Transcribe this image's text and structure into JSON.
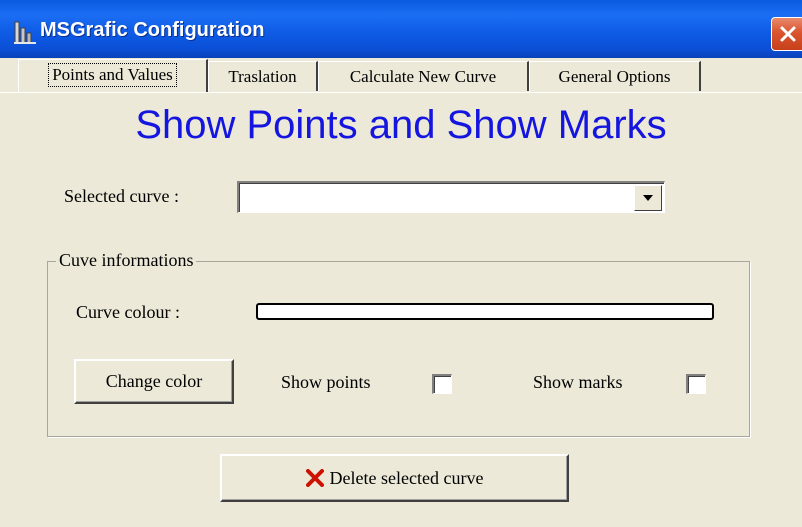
{
  "window": {
    "title": "MSGrafic Configuration",
    "title_color": "#ffffff",
    "titlebar_color": "#0b52dc",
    "close_button_color": "#d9542f"
  },
  "tabs": [
    {
      "label": "Points and Values",
      "active": true
    },
    {
      "label": "Traslation",
      "active": false
    },
    {
      "label": "Calculate New Curve",
      "active": false
    },
    {
      "label": "General Options",
      "active": false
    }
  ],
  "main": {
    "heading": "Show Points and Show Marks",
    "heading_color": "#1515e0",
    "selected_curve_label": "Selected curve :",
    "selected_curve_value": "",
    "group": {
      "title": "Cuve informations",
      "curve_colour_label": "Curve  colour :",
      "curve_colour_value": "#ffffff",
      "change_color_label": "Change color",
      "show_points_label": "Show points",
      "show_points_checked": false,
      "show_marks_label": "Show marks",
      "show_marks_checked": false
    },
    "delete_button_label": "Delete selected curve",
    "delete_icon_color": "#cc1100"
  },
  "icons": {
    "app": "bar-chart-icon",
    "close": "close-icon",
    "dropdown": "dropdown-arrow-icon",
    "delete": "red-x-icon"
  }
}
